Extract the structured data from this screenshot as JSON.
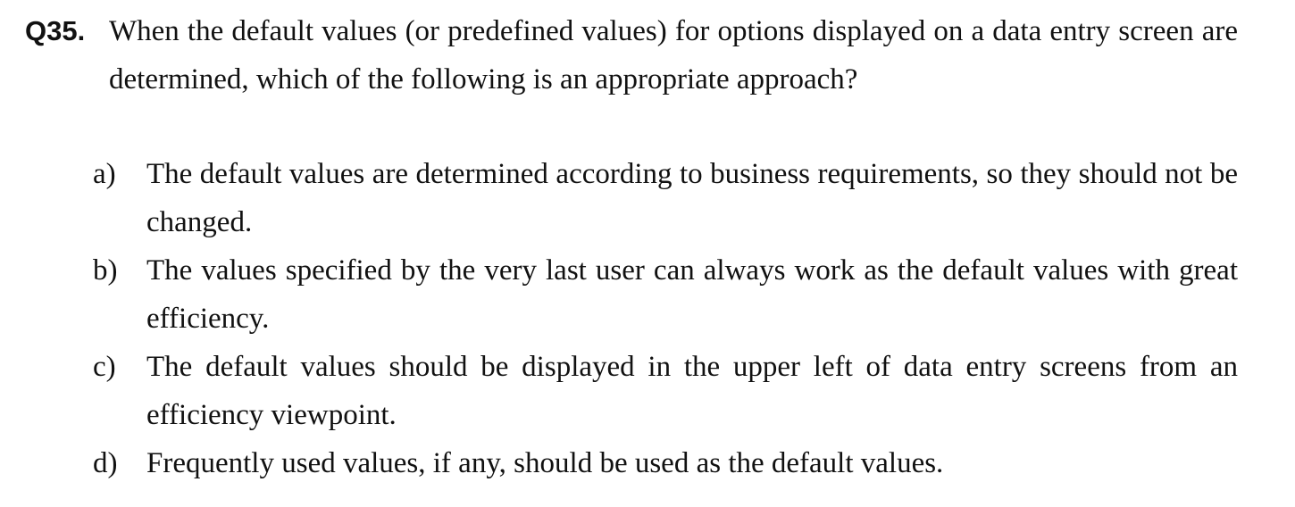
{
  "question": {
    "number": "Q35.",
    "text": "When the default values (or predefined values) for options displayed on a data entry screen are determined, which of the following is an appropriate approach?"
  },
  "choices": [
    {
      "letter": "a)",
      "text": "The default values are determined according to business requirements, so they should not be changed."
    },
    {
      "letter": "b)",
      "text": "The values specified by the very last user can always work as the default values with great efficiency."
    },
    {
      "letter": "c)",
      "text": "The default values should be displayed in the upper left of data entry screens from an efficiency viewpoint."
    },
    {
      "letter": "d)",
      "text": "Frequently used values, if any, should be used as the default values."
    }
  ]
}
